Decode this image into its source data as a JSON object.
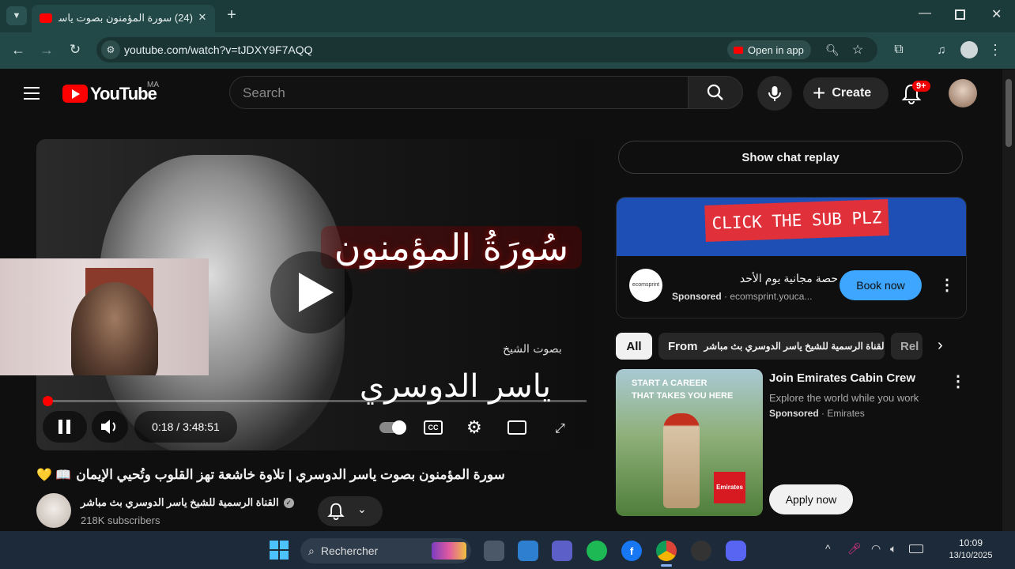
{
  "browser": {
    "tab_count": "(24)",
    "tab_title": "(24) سورة المؤمنون بصوت ياسر",
    "url": "youtube.com/watch?v=tJDXY9F7AQQ",
    "open_in_app": "Open in app",
    "new_tab": "+",
    "close": "✕"
  },
  "youtube": {
    "logo_text": "YouTube",
    "country": "MA",
    "search_placeholder": "Search",
    "create_label": "Create",
    "notif_count": "9+",
    "video": {
      "time": "0:18 / 3:48:51",
      "title_art": "سُورَةُ المؤمنون",
      "reciter_art": "ياسر الدوسري",
      "reciter_small": "بصوت الشيخ",
      "progress_fraction": 0.002
    },
    "title": "سورة المؤمنون بصوت ياسر الدوسري | تلاوة خاشعة تهز القلوب وتُحيي الإيمان",
    "title_emojis": "📖 💛",
    "channel": {
      "name": "القناة الرسمية للشيخ ياسر الدوسري بث مباشر",
      "subscribers": "218K subscribers"
    },
    "chat_replay": "Show chat replay",
    "ad1": {
      "banner_text": "CLICK THE SUB PLZ",
      "logo_text": "ecomsprint",
      "title": "حصة مجانية يوم الأحد",
      "sponsored": "Sponsored",
      "domain": "ecomsprint.youca...",
      "button": "Book now"
    },
    "chips": [
      "All",
      "From",
      "القناة الرسمية للشيخ ياسر الدوسري بث مباشر",
      "Rel"
    ],
    "ad2": {
      "image_text_1": "START A CAREER",
      "image_text_2": "THAT TAKES YOU HERE",
      "brand_badge": "Emirates",
      "title": "Join Emirates Cabin Crew",
      "desc": "Explore the world while you work",
      "sponsored": "Sponsored",
      "advertiser": "Emirates",
      "button": "Apply now"
    }
  },
  "taskbar": {
    "search": "Rechercher",
    "time": "10:09",
    "date": "13/10/2025"
  }
}
